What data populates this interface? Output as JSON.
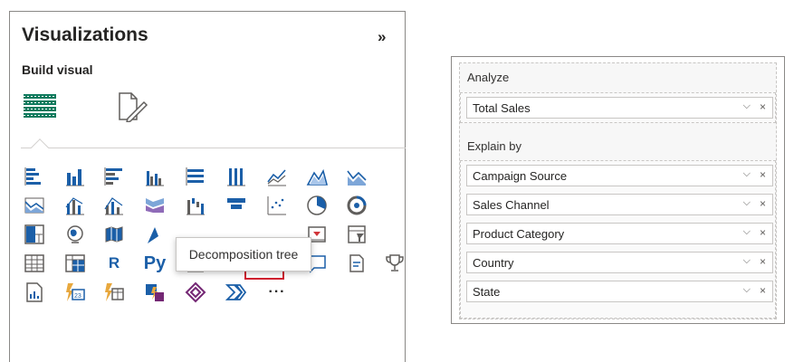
{
  "visualizations": {
    "title": "Visualizations",
    "build_label": "Build visual",
    "tooltip": "Decomposition tree",
    "r_label": "R",
    "py_label": "Py",
    "more_label": "···",
    "colors": {
      "accent": "#117865",
      "icon_blue": "#1b5fa8",
      "selected_border": "#d02030"
    }
  },
  "wells": {
    "analyze_label": "Analyze",
    "analyze_fields": [
      {
        "label": "Total Sales"
      }
    ],
    "explain_label": "Explain by",
    "explain_fields": [
      {
        "label": "Campaign Source"
      },
      {
        "label": "Sales Channel"
      },
      {
        "label": "Product Category"
      },
      {
        "label": "Country"
      },
      {
        "label": "State"
      }
    ]
  }
}
